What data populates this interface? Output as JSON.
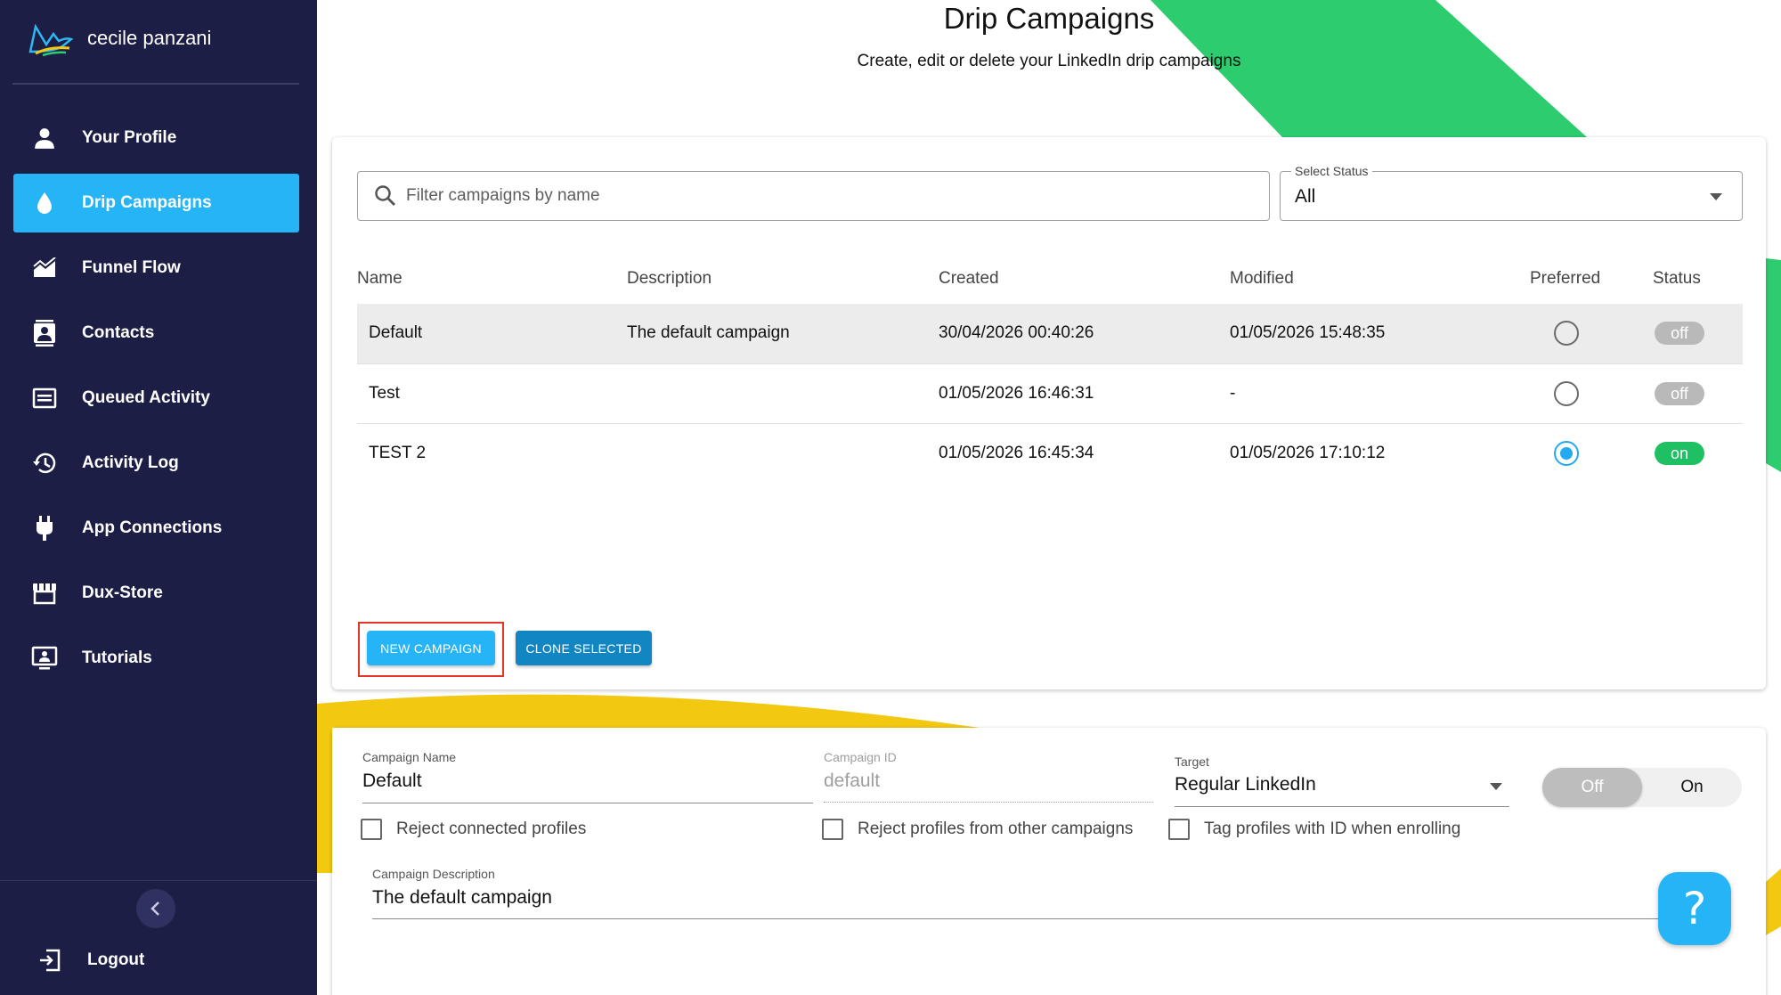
{
  "user": {
    "name": "cecile panzani"
  },
  "sidebar": {
    "items": [
      {
        "label": "Your Profile",
        "icon": "person-icon"
      },
      {
        "label": "Drip Campaigns",
        "icon": "drop-icon",
        "active": true
      },
      {
        "label": "Funnel Flow",
        "icon": "area-chart-icon"
      },
      {
        "label": "Contacts",
        "icon": "contact-card-icon"
      },
      {
        "label": "Queued Activity",
        "icon": "queue-icon"
      },
      {
        "label": "Activity Log",
        "icon": "history-icon"
      },
      {
        "label": "App Connections",
        "icon": "plug-icon"
      },
      {
        "label": "Dux-Store",
        "icon": "store-icon"
      },
      {
        "label": "Tutorials",
        "icon": "monitor-person-icon"
      }
    ],
    "logout_label": "Logout"
  },
  "header": {
    "title": "Drip Campaigns",
    "subtitle": "Create, edit or delete your LinkedIn drip campaigns"
  },
  "filters": {
    "search_placeholder": "Filter campaigns by name",
    "status_label": "Select Status",
    "status_value": "All"
  },
  "table": {
    "columns": [
      "Name",
      "Description",
      "Created",
      "Modified",
      "Preferred",
      "Status"
    ],
    "rows": [
      {
        "name": "Default",
        "description": "The default campaign",
        "created": "30/04/2026 00:40:26",
        "modified": "01/05/2026 15:48:35",
        "preferred": false,
        "status": "off"
      },
      {
        "name": "Test",
        "description": "",
        "created": "01/05/2026 16:46:31",
        "modified": "-",
        "preferred": false,
        "status": "off"
      },
      {
        "name": "TEST 2",
        "description": "",
        "created": "01/05/2026 16:45:34",
        "modified": "01/05/2026 17:10:12",
        "preferred": true,
        "status": "on"
      }
    ]
  },
  "actions": {
    "new_campaign": "NEW CAMPAIGN",
    "clone_selected": "CLONE SELECTED"
  },
  "form": {
    "campaign_name_label": "Campaign Name",
    "campaign_name_value": "Default",
    "campaign_id_label": "Campaign ID",
    "campaign_id_value": "default",
    "target_label": "Target",
    "target_value": "Regular LinkedIn",
    "toggle_off_label": "Off",
    "toggle_on_label": "On",
    "reject_connected_label": "Reject connected profiles",
    "reject_other_label": "Reject profiles from other campaigns",
    "tag_profiles_label": "Tag profiles with ID when enrolling",
    "description_label": "Campaign Description",
    "description_value": "The default campaign"
  },
  "help": {
    "label": "?"
  },
  "colors": {
    "sidebar_bg": "#1c1e45",
    "accent": "#25b4f5",
    "clone_button": "#1286c2",
    "status_on": "#1fc063",
    "status_off": "#b9b9b9",
    "deco_green": "#2dcc6f",
    "deco_yellow": "#f2c811",
    "highlight": "#e53529"
  }
}
